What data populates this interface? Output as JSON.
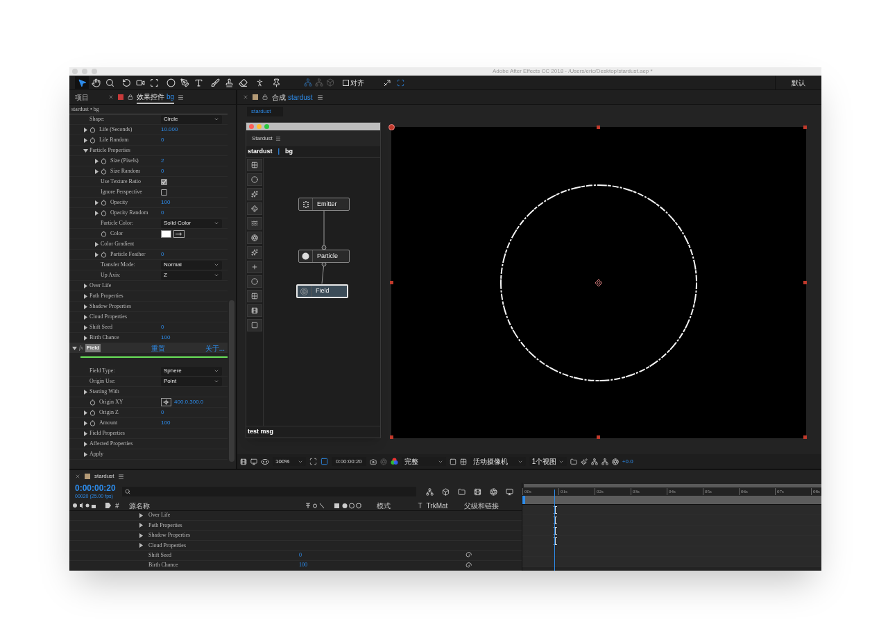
{
  "window": {
    "title": "Adobe After Effects CC 2018 - /Users/eric/Desktop/stardust.aep *"
  },
  "toolbar": {
    "tools": [
      {
        "kind": "select",
        "selected": true
      },
      {
        "kind": "hand",
        "selected": false
      },
      {
        "kind": "zoom",
        "selected": false
      },
      {
        "kind": "rotate",
        "selected": false
      },
      {
        "kind": "camera",
        "selected": false
      },
      {
        "kind": "pan",
        "selected": false
      },
      {
        "kind": "ellipse",
        "selected": false
      },
      {
        "kind": "pen",
        "selected": false
      },
      {
        "kind": "text",
        "selected": false
      },
      {
        "kind": "brush",
        "selected": false
      },
      {
        "kind": "stamp",
        "selected": false
      },
      {
        "kind": "eraser",
        "selected": false
      },
      {
        "kind": "puppet",
        "selected": false
      },
      {
        "kind": "pin",
        "selected": false
      }
    ],
    "snap": {
      "label": "对齐",
      "checked": false
    },
    "workspace": "默认"
  },
  "effect_panel": {
    "tabs": [
      {
        "label": "项目",
        "selected": false
      },
      {
        "label": "效果控件",
        "target": "bg",
        "selected": true
      }
    ],
    "breadcrumb": "stardust • bg",
    "rows": [
      {
        "label": "Shape:",
        "kind": "dropdown",
        "value": "Circle"
      },
      {
        "label": "Life (Seconds)",
        "kind": "number",
        "expandable": true,
        "expanded": false,
        "stopwatch": true,
        "value": "10.000"
      },
      {
        "label": "Life Random",
        "kind": "number",
        "expandable": true,
        "expanded": false,
        "stopwatch": true,
        "value": "0"
      },
      {
        "label": "Particle Properties",
        "kind": "group",
        "expandable": true,
        "expanded": true,
        "children": [
          {
            "label": "Size (Pixels)",
            "kind": "number",
            "expandable": true,
            "expanded": false,
            "stopwatch": true,
            "value": "2"
          },
          {
            "label": "Size Random",
            "kind": "number",
            "expandable": true,
            "expanded": false,
            "stopwatch": true,
            "value": "0"
          },
          {
            "label": "Use Texture Ratio",
            "kind": "checkbox",
            "checked": true
          },
          {
            "label": "Ignore Perspective",
            "kind": "checkbox",
            "checked": false
          },
          {
            "label": "Opacity",
            "kind": "number",
            "expandable": true,
            "expanded": false,
            "stopwatch": true,
            "value": "100"
          },
          {
            "label": "Opacity Random",
            "kind": "number",
            "expandable": true,
            "expanded": false,
            "stopwatch": true,
            "value": "0"
          },
          {
            "label": "Particle Color:",
            "kind": "dropdown",
            "value": "Solid Color"
          },
          {
            "label": "Color",
            "kind": "color",
            "stopwatch": true,
            "color": "#ffffff"
          },
          {
            "label": "Color Gradient",
            "kind": "group",
            "expandable": true,
            "expanded": false
          },
          {
            "label": "Particle Feather",
            "kind": "number",
            "expandable": true,
            "expanded": false,
            "stopwatch": true,
            "value": "0"
          },
          {
            "label": "Transfer Mode:",
            "kind": "dropdown",
            "value": "Normal"
          },
          {
            "label": "Up Axis:",
            "kind": "dropdown",
            "value": "Z"
          }
        ]
      },
      {
        "label": "Over Life",
        "kind": "group",
        "expandable": true,
        "expanded": false
      },
      {
        "label": "Path Properties",
        "kind": "group",
        "expandable": true,
        "expanded": false
      },
      {
        "label": "Shadow Properties",
        "kind": "group",
        "expandable": true,
        "expanded": false
      },
      {
        "label": "Cloud Properties",
        "kind": "group",
        "expandable": true,
        "expanded": false
      },
      {
        "label": "Shift Seed",
        "kind": "number",
        "expandable": true,
        "expanded": false,
        "value": "0"
      },
      {
        "label": "Birth Chance",
        "kind": "number",
        "expandable": true,
        "expanded": false,
        "value": "100"
      }
    ],
    "field_effect": {
      "fx_label": "fx",
      "name": "Field",
      "expanded": true,
      "reset": "重置",
      "about": "关于...",
      "rows": [
        {
          "label": "Field Type:",
          "kind": "dropdown",
          "value": "Sphere"
        },
        {
          "label": "Origin Use:",
          "kind": "dropdown",
          "value": "Point"
        },
        {
          "label": "Starting With",
          "kind": "group",
          "expandable": true,
          "expanded": false
        },
        {
          "label": "Origin XY",
          "kind": "point",
          "stopwatch": true,
          "value": "400.0,300.0"
        },
        {
          "label": "Origin Z",
          "kind": "number",
          "expandable": true,
          "expanded": false,
          "stopwatch": true,
          "value": "0"
        },
        {
          "label": "Amount",
          "kind": "number",
          "expandable": true,
          "expanded": false,
          "stopwatch": true,
          "value": "100"
        },
        {
          "label": "Field Properties",
          "kind": "group",
          "expandable": true,
          "expanded": false
        },
        {
          "label": "Affected Properties",
          "kind": "group",
          "expandable": true,
          "expanded": false
        },
        {
          "label": "Apply",
          "kind": "group",
          "expandable": true,
          "expanded": false
        }
      ]
    }
  },
  "comp_panel": {
    "tab": {
      "label": "合成",
      "target": "stardust"
    },
    "comp_tab": "stardust",
    "viewer_bar": {
      "zoom": "100%",
      "timecode": "0:00:00:20",
      "resolution": "完整",
      "camera": "活动摄像机",
      "views": "1个视图",
      "exposure": "+0.0"
    }
  },
  "stardust_window": {
    "title": "Stardust",
    "path": [
      "stardust",
      "bg"
    ],
    "separator": "|",
    "nodes": [
      {
        "label": "Emitter",
        "kind": "emitter",
        "selected": false
      },
      {
        "label": "Particle",
        "kind": "particle",
        "selected": false
      },
      {
        "label": "Field",
        "kind": "field",
        "selected": true
      }
    ],
    "status": "test msg"
  },
  "timeline": {
    "comp": "stardust",
    "timecode": "0:00:00:20",
    "frame_info": "00020 (25.00 fps)",
    "columns": {
      "hash": "#",
      "source_name": "源名称",
      "mode": "模式",
      "t": "T",
      "trkmat": "TrkMat",
      "parent": "父级和链接"
    },
    "rows": [
      {
        "label": "Over Life",
        "expandable": true,
        "keyframe": true
      },
      {
        "label": "Path Properties",
        "expandable": true,
        "keyframe": true
      },
      {
        "label": "Shadow Properties",
        "expandable": true,
        "keyframe": true
      },
      {
        "label": "Cloud Properties",
        "expandable": true,
        "keyframe": true
      },
      {
        "label": "Shift Seed",
        "expandable": false,
        "value": "0",
        "expression": true
      },
      {
        "label": "Birth Chance",
        "expandable": false,
        "value": "100",
        "expression": true
      }
    ],
    "ruler": [
      "00s",
      "01s",
      "02s",
      "03s",
      "04s",
      "05s",
      "06s",
      "07s",
      "08s"
    ]
  }
}
